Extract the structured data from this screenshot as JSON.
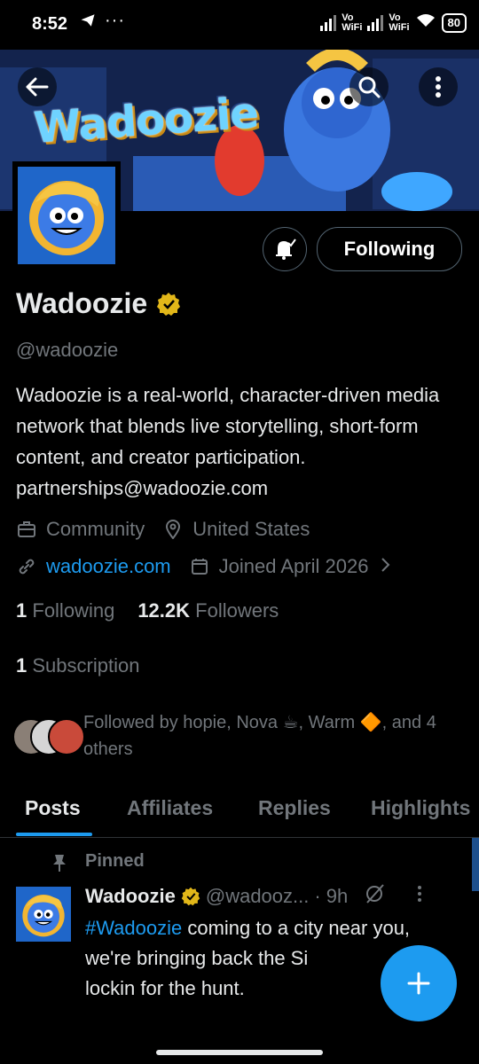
{
  "status_bar": {
    "time": "8:52",
    "dots": "···",
    "vowifi1": "Vo\nWiFi",
    "vowifi2": "Vo\nWiFi",
    "battery": "80"
  },
  "banner": {
    "logo_text": "Wadoozie"
  },
  "profile": {
    "follow_button": "Following",
    "name": "Wadoozie",
    "handle": "@wadoozie",
    "bio": "Wadoozie is a real-world, character-driven media network that blends live storytelling, short-form content, and creator participation. partnerships@wadoozie.com",
    "category": "Community",
    "location": "United States",
    "website": "wadoozie.com",
    "joined": "Joined April 2026",
    "following_count": "1",
    "following_label": "Following",
    "followers_count": "12.2K",
    "followers_label": "Followers",
    "subscription_count": "1",
    "subscription_label": "Subscription",
    "followed_by": "Followed by hopie, Nova ☕, Warm 🔶, and 4 others"
  },
  "tabs": [
    {
      "label": "Posts",
      "active": true
    },
    {
      "label": "Affiliates",
      "active": false
    },
    {
      "label": "Replies",
      "active": false
    },
    {
      "label": "Highlights",
      "active": false
    }
  ],
  "post": {
    "pinned_label": "Pinned",
    "author": "Wadoozie",
    "handle": "@wadooz...",
    "time": "· 9h",
    "hashtag": "#Wadoozie",
    "text_rest": " coming to a city near you, we're bringing back the Si",
    "text_line3": "lockin for the hunt."
  },
  "colors": {
    "accent": "#1d9bf0",
    "background": "#000000",
    "muted": "#71767b",
    "verified": "#e2b719"
  }
}
